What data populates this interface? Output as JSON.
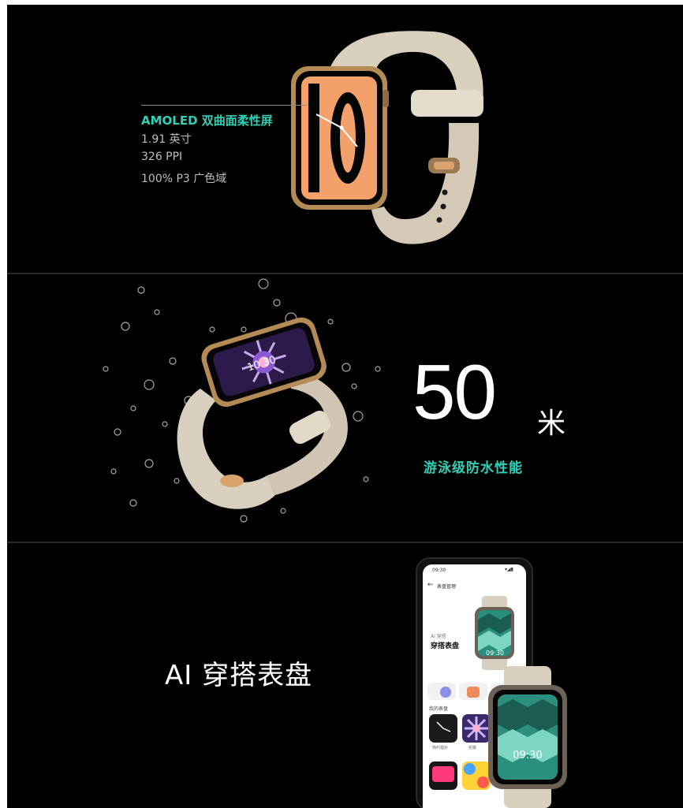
{
  "display_panel": {
    "spec_title": "AMOLED 双曲面柔性屏",
    "specs": [
      "1.91 英寸",
      "326 PPI",
      "100% P3 广色域"
    ],
    "watch_face_number": "10"
  },
  "waterproof_panel": {
    "depth_number": "50",
    "depth_unit": "米",
    "subtitle": "游泳级防水性能",
    "watch_time": "10 30"
  },
  "ai_panel": {
    "title": "AI 穿搭表盘",
    "phone": {
      "status_time": "09:30",
      "nav_title": "表盘管理",
      "section_small": "AI 穿搭",
      "section_title": "穿搭表盘",
      "preview_time": "09:30",
      "my_faces_label": "我的表盘",
      "face_labels": [
        "简约指针",
        "花瓣"
      ]
    },
    "watch_time": "09:30"
  },
  "colors": {
    "accent_teal": "#2fd1b6",
    "background": "#000000",
    "strap_beige": "#d9cfbd",
    "case_gold": "#b48a55",
    "face_orange": "#f3a06a",
    "pattern_green": "#2a8f7c"
  }
}
